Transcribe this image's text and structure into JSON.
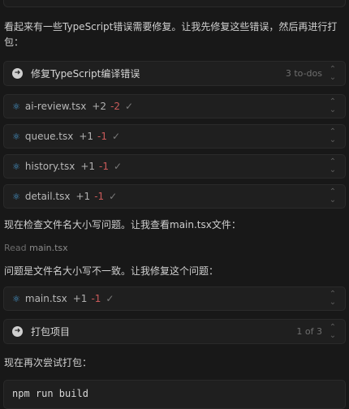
{
  "messages": {
    "m1": "看起来有一些TypeScript错误需要修复。让我先修复这些错误，然后再进行打包：",
    "m2": "现在检查文件名大小写问题。让我查看main.tsx文件：",
    "m3": "问题是文件名大小写不一致。让我修复这个问题：",
    "m4": "现在再次尝试打包："
  },
  "task1": {
    "title": "修复TypeScript编译错误",
    "meta": "3 to-dos"
  },
  "files": [
    {
      "name": "ai-review.tsx",
      "added": "+2",
      "removed": "-2"
    },
    {
      "name": "queue.tsx",
      "added": "+1",
      "removed": "-1"
    },
    {
      "name": "history.tsx",
      "added": "+1",
      "removed": "-1"
    },
    {
      "name": "detail.tsx",
      "added": "+1",
      "removed": "-1"
    }
  ],
  "read": {
    "label": "Read",
    "file": "main.tsx"
  },
  "file_main": {
    "name": "main.tsx",
    "added": "+1",
    "removed": "-1"
  },
  "task2": {
    "title": "打包项目",
    "meta": "1 of 3"
  },
  "command": "npm run build",
  "icons": {
    "file": "react-icon",
    "task": "arrow-right-circle-icon",
    "check": "check-icon",
    "chevron": "chevron-updown-icon"
  },
  "colors": {
    "background": "#181818",
    "card": "#1f1f1f",
    "react": "#4a9fd8",
    "removed": "#c95a5a"
  }
}
